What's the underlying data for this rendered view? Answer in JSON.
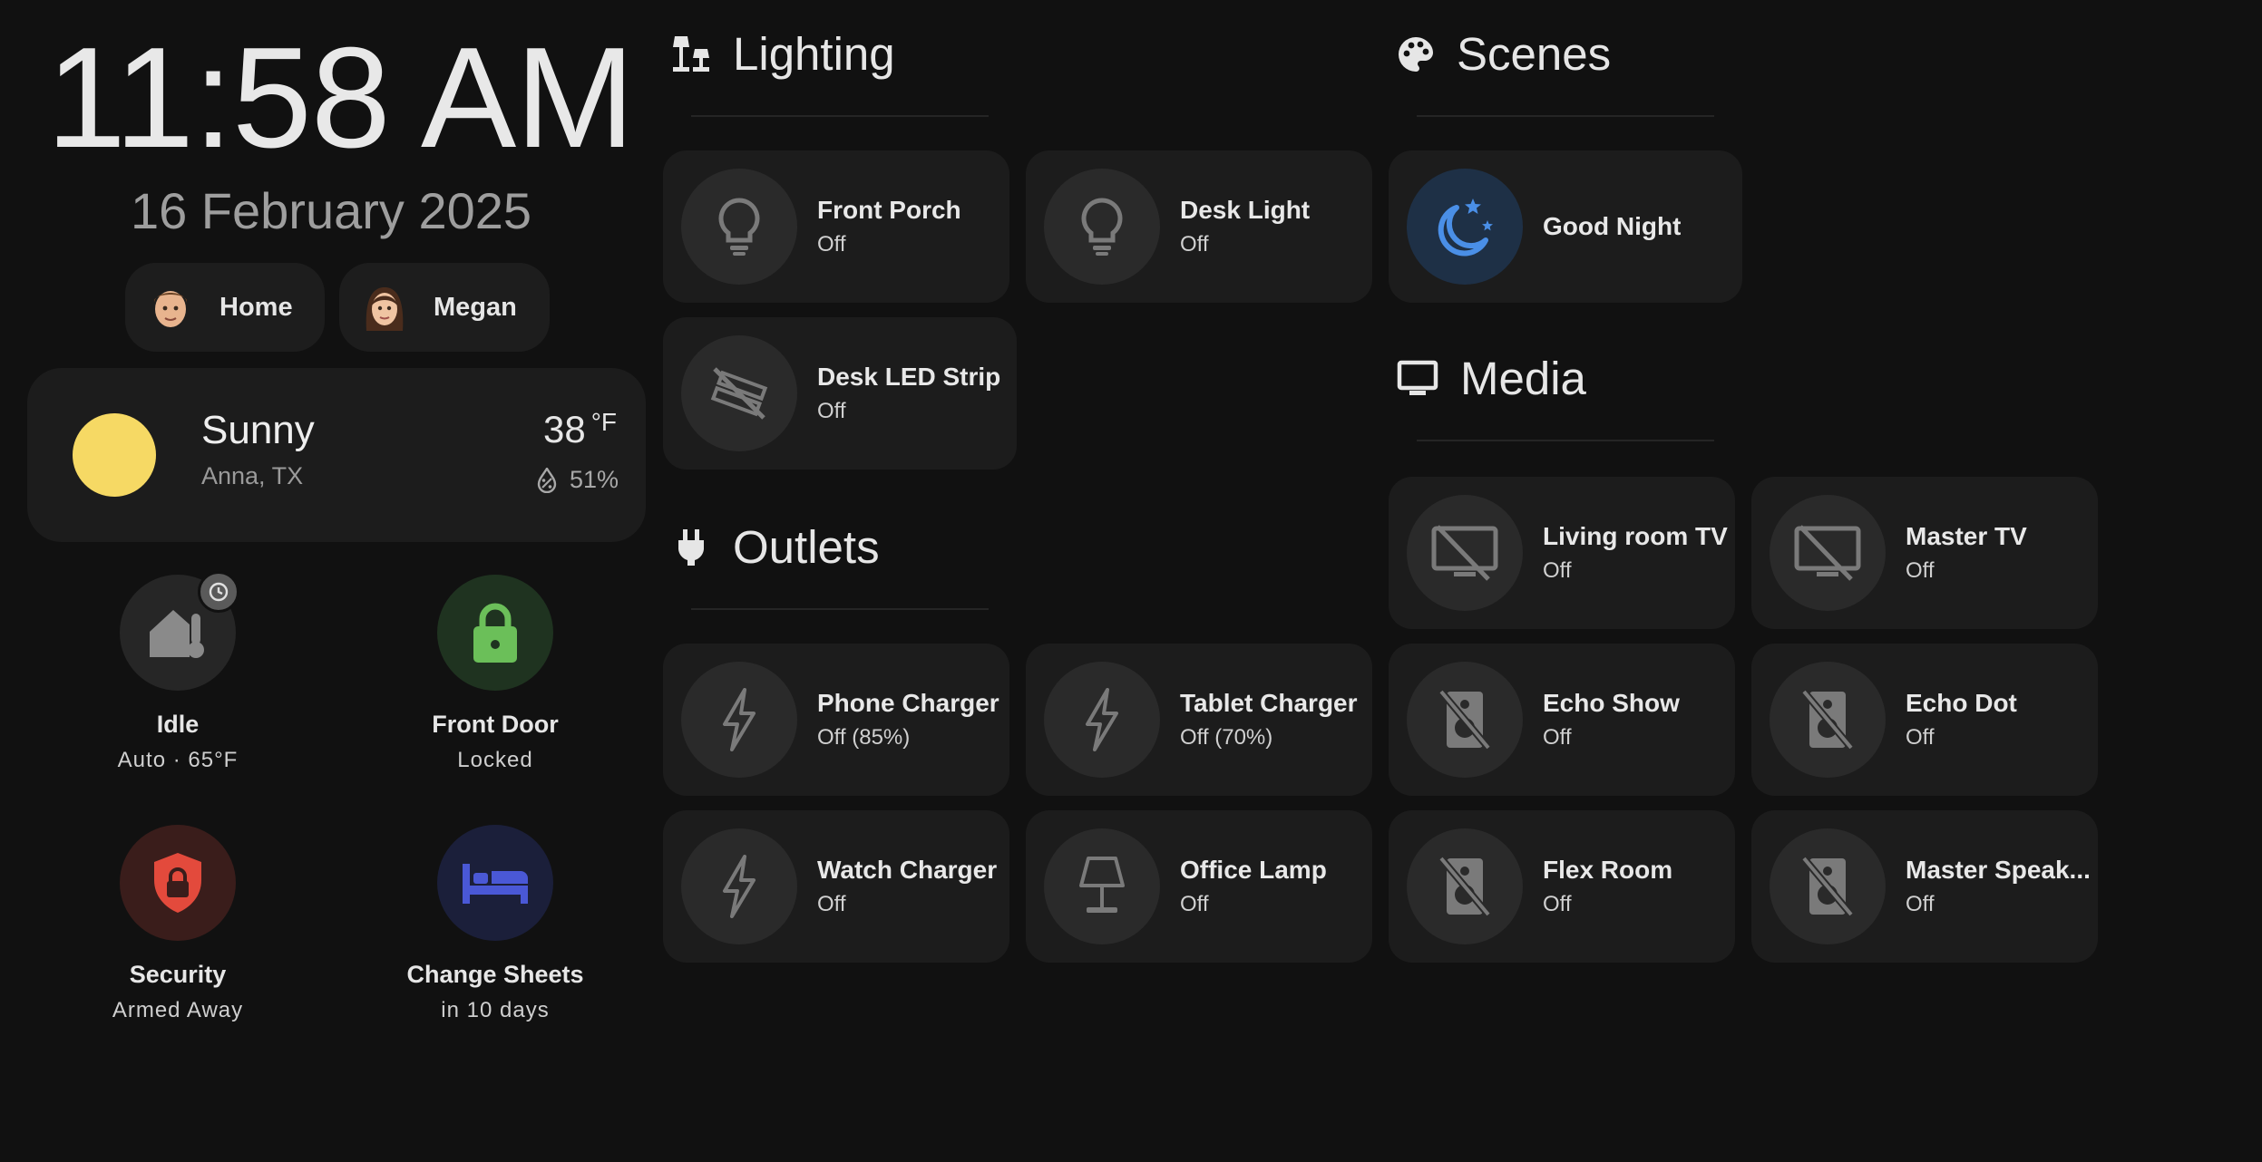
{
  "clock": {
    "time": "11:58 AM",
    "date": "16 February 2025"
  },
  "people": [
    {
      "name": "Home"
    },
    {
      "name": "Megan"
    }
  ],
  "weather": {
    "condition": "Sunny",
    "location": "Anna, TX",
    "temperature": "38",
    "unit": "°F",
    "humidity": "51%"
  },
  "tiles": {
    "climate": {
      "name": "Idle",
      "state": "Auto · 65°F"
    },
    "door": {
      "name": "Front Door",
      "state": "Locked"
    },
    "security": {
      "name": "Security",
      "state": "Armed Away"
    },
    "sheets": {
      "name": "Change Sheets",
      "state": "in 10 days"
    }
  },
  "sections": {
    "lighting": "Lighting",
    "outlets": "Outlets",
    "scenes": "Scenes",
    "media": "Media"
  },
  "lighting": [
    {
      "name": "Front Porch",
      "state": "Off"
    },
    {
      "name": "Desk Light",
      "state": "Off"
    },
    {
      "name": "Desk LED Strip",
      "state": "Off"
    }
  ],
  "outlets": [
    {
      "name": "Phone Charger",
      "state": "Off (85%)"
    },
    {
      "name": "Tablet Charger",
      "state": "Off (70%)"
    },
    {
      "name": "Watch Charger",
      "state": "Off"
    },
    {
      "name": "Office Lamp",
      "state": "Off"
    }
  ],
  "scenes": [
    {
      "name": "Good Night"
    }
  ],
  "media": [
    {
      "name": "Living room TV",
      "state": "Off"
    },
    {
      "name": "Master TV",
      "state": "Off"
    },
    {
      "name": "Echo Show",
      "state": "Off"
    },
    {
      "name": "Echo Dot",
      "state": "Off"
    },
    {
      "name": "Flex Room",
      "state": "Off"
    },
    {
      "name": "Master Speak...",
      "state": "Off"
    }
  ],
  "icons": {
    "bulb": "lightbulb-icon",
    "led_off": "led-strip-off-icon",
    "bolt": "lightning-bolt-icon",
    "lamp": "desk-lamp-icon",
    "tv_off": "tv-off-icon",
    "speaker_off": "speaker-off-icon",
    "moon": "weather-night-icon"
  },
  "colors": {
    "background": "#111111",
    "card": "#1c1c1c",
    "sun": "#f6d964",
    "lock_green": "#6bbf59",
    "security_red": "#e34a3c",
    "sheets_blue": "#4a58d6",
    "scene_blue": "#4a8fe7"
  }
}
